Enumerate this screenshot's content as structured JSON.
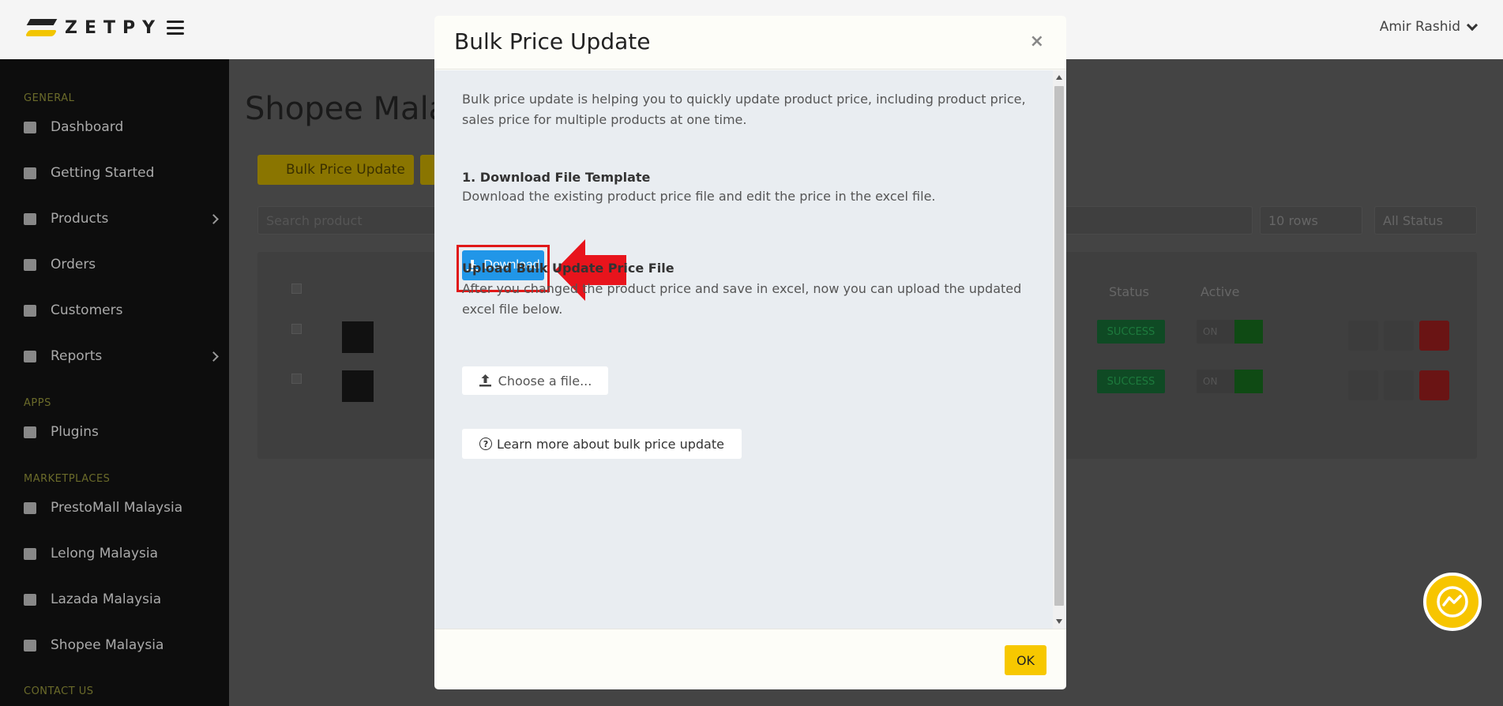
{
  "app": {
    "logo_text": "ZETPY",
    "user_name": "Amir Rashid"
  },
  "sidebar": {
    "sections": [
      "GENERAL",
      "APPS",
      "MARKETPLACES",
      "CONTACT US"
    ],
    "items": [
      {
        "label": "Dashboard",
        "icon": "home-icon"
      },
      {
        "label": "Getting Started",
        "icon": "book-icon"
      },
      {
        "label": "Products",
        "icon": "cubes-icon"
      },
      {
        "label": "Orders",
        "icon": "list-icon"
      },
      {
        "label": "Customers",
        "icon": "users-icon"
      },
      {
        "label": "Reports",
        "icon": "chart-icon"
      },
      {
        "label": "Plugins",
        "icon": "plug-icon"
      },
      {
        "label": "PrestoMall Malaysia",
        "icon": "store-icon"
      },
      {
        "label": "Lelong Malaysia",
        "icon": "store-icon"
      },
      {
        "label": "Lazada Malaysia",
        "icon": "store-icon"
      },
      {
        "label": "Shopee Malaysia",
        "icon": "store-icon"
      }
    ]
  },
  "page": {
    "title": "Shopee Mala",
    "bulk_button": "Bulk Price Update",
    "search_placeholder": "Search product",
    "rows_select": "10 rows",
    "status_select": "All Status",
    "columns": {
      "status": "Status",
      "active": "Active"
    },
    "rows": [
      {
        "status": "SUCCESS",
        "toggle": "ON"
      },
      {
        "status": "SUCCESS",
        "toggle": "ON"
      }
    ]
  },
  "modal": {
    "title": "Bulk Price Update",
    "close": "×",
    "intro": "Bulk price update is helping you to quickly update product price, including product price, sales price for multiple products at one time.",
    "step1_title": "1. Download File Template",
    "step1_text": "Download the existing product price file and edit the price in the excel file.",
    "download_label": "Download",
    "step2_title": "Upload Bulk Update Price File",
    "step2_text": "After you changed the product price and save in excel, now you can upload the updated excel file below.",
    "choose_file_label": "Choose a file...",
    "learn_more_label": "Learn more about bulk price update",
    "ok_label": "OK"
  },
  "colors": {
    "download_blue": "#2196e8",
    "ok_yellow": "#f7c800",
    "highlight_red": "#e01818",
    "messenger_yellow": "#f7c500"
  }
}
